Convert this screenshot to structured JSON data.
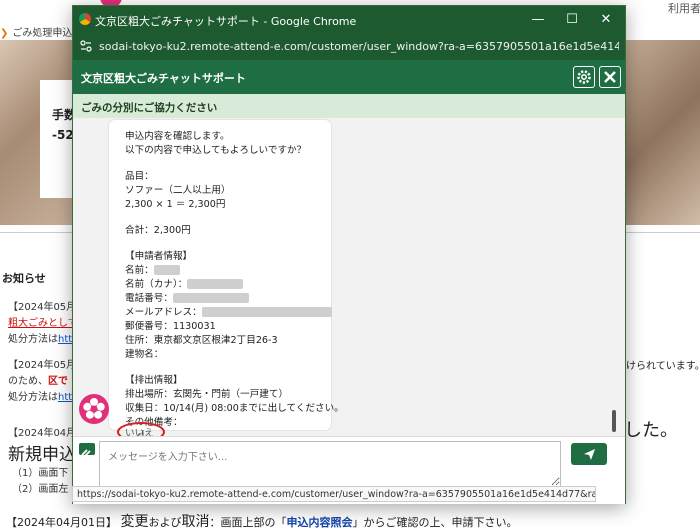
{
  "background": {
    "top_right": "利用者登",
    "breadcrumb": "ごみ処理申込",
    "fee_label": "手数",
    "fee_value": "-529",
    "news_title": "お知らせ",
    "lines": [
      {
        "text": "【2024年05月"
      },
      {
        "text": "粗大ごみとして"
      },
      {
        "text": "処分方法は"
      },
      {
        "text": "http"
      },
      {
        "text": "【2024年05月"
      },
      {
        "text": "のため、"
      },
      {
        "text": "区で"
      },
      {
        "text": "処分方法は"
      },
      {
        "text": "http"
      },
      {
        "text": "【2024年04月"
      }
    ],
    "big_heading": "新規申込",
    "sub1": "（1）画面下",
    "sub2": "（2）画面左",
    "right_text": "けられています。",
    "right_big": "した。",
    "bottom_date": "【2024年04月01日】",
    "bottom_word1": "変更",
    "bottom_and": "および",
    "bottom_word2": "取消",
    "bottom_rest1": "：画面上部の「",
    "bottom_link": "申込内容照会",
    "bottom_rest2": "」からご確認の上、申請下さい。"
  },
  "window": {
    "title": "文京区粗大ごみチャットサポート - Google Chrome",
    "url": "sodai-tokyo-ku2.remote-attend-e.com/customer/user_window?ra-a=6357905501a16e1d5e414d77&ra-b=65152...",
    "min_label": "—",
    "max_label": "☐",
    "close_label": "✕"
  },
  "app": {
    "header_title": "文京区粗大ごみチャットサポート",
    "subheader": "ごみの分別にご協力ください",
    "gear_icon": "gear-icon",
    "close_icon": "close-icon"
  },
  "chat": {
    "lines": [
      "申込内容を確認します。",
      "以下の内容で申込してもよろしいですか？",
      "",
      "品目：",
      "ソファー（二人以上用）",
      "2,300 × 1 ＝ 2,300円",
      "",
      "合計：2,300円",
      "",
      "【申請者情報】",
      "名前：",
      "名前（カナ）：",
      "電話番号：",
      "メールアドレス：",
      "郵便番号：1130031",
      "住所：東京都文京区根津2丁目26-3",
      "建物名：",
      "",
      "【排出情報】",
      "排出場所：玄関先・門前（一戸建て）",
      "収集日：10/14(月) 08:00までに出してください。",
      "その他備考："
    ],
    "option_no": "いいえ",
    "option_yes": "はい"
  },
  "footer": {
    "placeholder": "メッセージを入力下さい..."
  },
  "statusbar": "https://sodai-tokyo-ku2.remote-attend-e.com/customer/user_window?ra-a=6357905501a16e1d5e414d77&ra-b=6515274e430922fee..."
}
